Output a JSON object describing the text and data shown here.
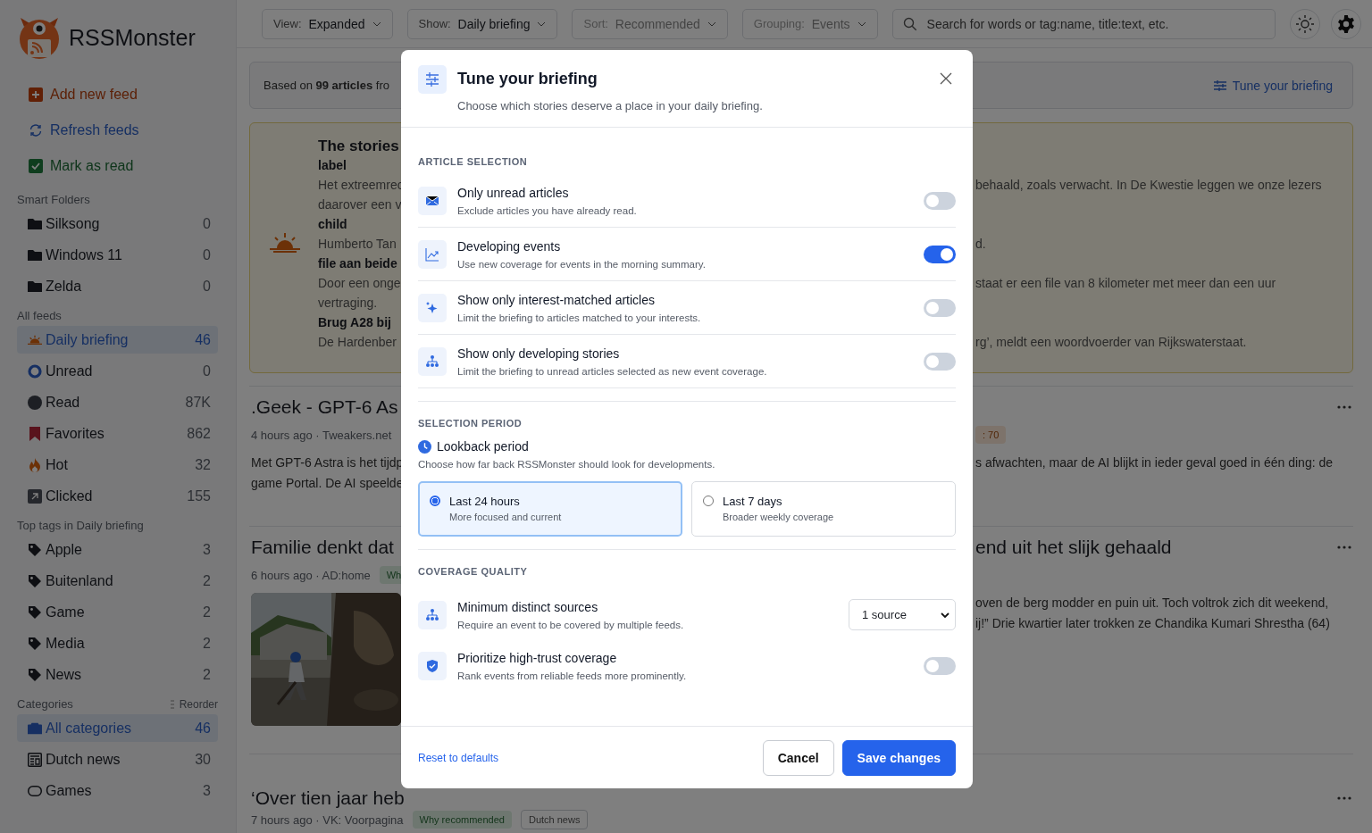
{
  "sidebar": {
    "app_name": "RSSMonster",
    "actions": [
      {
        "label": "Add new feed",
        "kind": "add"
      },
      {
        "label": "Refresh feeds",
        "kind": "refresh"
      },
      {
        "label": "Mark as read",
        "kind": "check"
      }
    ],
    "sections": [
      {
        "title": "Smart Folders",
        "items": [
          {
            "label": "Silksong",
            "count": "0",
            "kind": "folder",
            "selected": false
          },
          {
            "label": "Windows 11",
            "count": "0",
            "kind": "folder",
            "selected": false
          },
          {
            "label": "Zelda",
            "count": "0",
            "kind": "folder",
            "selected": false
          }
        ]
      },
      {
        "title": "All feeds",
        "items": [
          {
            "label": "Daily briefing",
            "count": "46",
            "kind": "briefing",
            "selected": true
          },
          {
            "label": "Unread",
            "count": "0",
            "kind": "unread",
            "selected": false
          },
          {
            "label": "Read",
            "count": "87K",
            "kind": "read",
            "selected": false
          },
          {
            "label": "Favorites",
            "count": "862",
            "kind": "favorite",
            "selected": false
          },
          {
            "label": "Hot",
            "count": "32",
            "kind": "hot",
            "selected": false
          },
          {
            "label": "Clicked",
            "count": "155",
            "kind": "clicked",
            "selected": false
          }
        ]
      },
      {
        "title": "Top tags in Daily briefing",
        "items": [
          {
            "label": "Apple",
            "count": "3",
            "kind": "tag",
            "selected": false
          },
          {
            "label": "Buitenland",
            "count": "2",
            "kind": "tag",
            "selected": false
          },
          {
            "label": "Game",
            "count": "2",
            "kind": "tag",
            "selected": false
          },
          {
            "label": "Media",
            "count": "2",
            "kind": "tag",
            "selected": false
          },
          {
            "label": "News",
            "count": "2",
            "kind": "tag",
            "selected": false
          }
        ]
      },
      {
        "title": "Categories",
        "action": "Reorder",
        "items": [
          {
            "label": "All categories",
            "count": "46",
            "kind": "all",
            "selected": true
          },
          {
            "label": "Dutch news",
            "count": "30",
            "kind": "newspaper",
            "selected": false
          },
          {
            "label": "Games",
            "count": "3",
            "kind": "games",
            "selected": false
          }
        ]
      }
    ]
  },
  "toolbar": {
    "filters": [
      {
        "label": "View:",
        "value": "Expanded",
        "disabled": false
      },
      {
        "label": "Show:",
        "value": "Daily briefing",
        "disabled": false
      },
      {
        "label": "Sort:",
        "value": "Recommended",
        "disabled": true
      },
      {
        "label": "Grouping:",
        "value": "Events",
        "disabled": true
      }
    ],
    "search": {
      "placeholder": "Search for words or tag:name, title:text, etc."
    }
  },
  "briefing_info": {
    "text": "Based on **99 articles** fro",
    "link": "Tune your briefing"
  },
  "summary": {
    "title": "The stories",
    "items": [
      {
        "heading": "label",
        "lines": [
          "Het extreemrec",
          "daarover een v"
        ],
        "tail": "behaald, zoals verwacht. In De Kwestie leggen we onze lezers"
      },
      {
        "heading": "child",
        "lines": [
          "Humberto Tan"
        ],
        "tail": "d."
      },
      {
        "heading": "file aan beide",
        "lines": [
          "Door een onge",
          "vertraging."
        ],
        "tail": "staat er een file van 8 kilometer met meer dan een uur"
      },
      {
        "heading": "Brug A28 bij",
        "lines": [
          "De Hardenber"
        ],
        "tail": "rg’, meldt een woordvoerder van Rijkswaterstaat."
      }
    ]
  },
  "articles": [
    {
      "title_left": ".Geek - GPT-6 As",
      "meta": "4 hours ago · Tweakers.net",
      "tags_right": [
        {
          "label": ": 70",
          "kind": "score"
        }
      ],
      "body": [
        {
          "left": "Met GPT-6 Astra is het tijdp",
          "right": "s afwachten, maar de AI blijkt in ieder geval goed in één ding: de"
        },
        {
          "left": "game Portal. De AI speelde"
        }
      ]
    },
    {
      "title_left": "Familie denkt dat",
      "title_right": "end uit het slijk gehaald",
      "meta": "6 hours ago · AD:home",
      "tags_left": [
        {
          "label": "Wh",
          "kind": "why"
        }
      ],
      "body": [
        {
          "right": "oven de berg modder en puin uit. Toch voltrok zich dit weekend,"
        },
        {
          "right": "ij!” Drie kwartier later trokken ze Chandika Kumari Shrestha (64)"
        }
      ],
      "media": {
        "kind": "picture"
      }
    }
  ],
  "last_article": {
    "title": "‘Over tien jaar heb",
    "meta": "7 hours ago · VK: Voorpagina",
    "tags": [
      {
        "label": "Why recommended",
        "kind": "why"
      },
      {
        "label": "Dutch news",
        "kind": "category"
      }
    ]
  },
  "dialog": {
    "title": "Tune your briefing",
    "subtitle": "Choose which stories deserve a place in your daily briefing.",
    "selection": {
      "title": "ARTICLE SELECTION",
      "rows": [
        {
          "kind": "toggle",
          "label": "Only unread articles",
          "description": "Exclude articles you have already read.",
          "on": false
        },
        {
          "kind": "toggle",
          "label": "Developing events",
          "description": "Use new coverage for events in the morning summary.",
          "on": true
        },
        {
          "kind": "toggle",
          "label": "Show only interest-matched articles",
          "description": "Limit the briefing to articles matched to your interests.",
          "on": false
        },
        {
          "kind": "toggle",
          "label": "Show only developing stories",
          "description": "Limit the briefing to unread articles selected as new event coverage.",
          "on": false
        }
      ]
    },
    "period": {
      "title": "SELECTION PERIOD",
      "heading": "Lookback period",
      "description": "Choose how far back RSSMonster should look for developments.",
      "options": [
        {
          "label": "Last 24 hours",
          "description": "More focused and current",
          "selected": true
        },
        {
          "label": "Last 7 days",
          "description": "Broader weekly coverage",
          "selected": false
        }
      ]
    },
    "quality": {
      "title": "COVERAGE QUALITY",
      "rows": [
        {
          "kind": "select",
          "label": "Minimum distinct sources",
          "description": "Require an event to be covered by multiple feeds.",
          "value": "1 source"
        },
        {
          "kind": "toggle",
          "label": "Prioritize high-trust coverage",
          "description": "Rank events from reliable feeds more prominently.",
          "on": false
        }
      ]
    },
    "reset": "Reset to defaults",
    "cancel": "Cancel",
    "save": "Save changes"
  }
}
